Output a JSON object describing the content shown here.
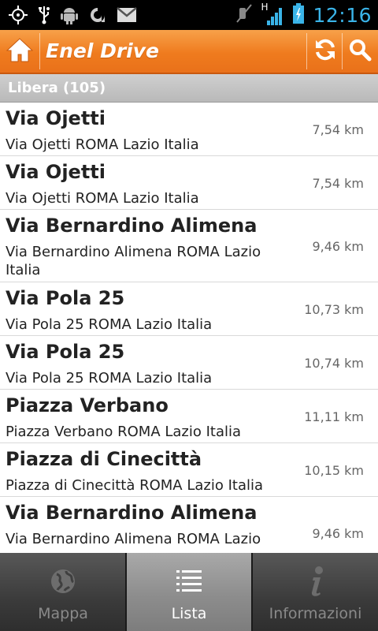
{
  "status_bar": {
    "time": "12:16",
    "network_type": "H",
    "left_icons": [
      "gps-icon",
      "usb-icon",
      "android-debug-icon",
      "app-icon",
      "gmail-icon"
    ],
    "right_icons": [
      "mute-icon",
      "signal-icon",
      "battery-charging-icon"
    ]
  },
  "action_bar": {
    "title": "Enel Drive",
    "home_icon": "home-icon",
    "refresh_icon": "refresh-icon",
    "search_icon": "search-icon",
    "color": "#ef7b1e"
  },
  "section": {
    "label": "Libera (105)"
  },
  "list": [
    {
      "title": "Via Ojetti",
      "address": "Via Ojetti ROMA Lazio Italia",
      "distance": "7,54 km"
    },
    {
      "title": "Via Ojetti",
      "address": "Via Ojetti ROMA Lazio Italia",
      "distance": "7,54 km"
    },
    {
      "title": "Via Bernardino Alimena",
      "address": "Via Bernardino Alimena ROMA Lazio Italia",
      "distance": "9,46 km"
    },
    {
      "title": "Via Pola 25",
      "address": "Via Pola 25 ROMA Lazio Italia",
      "distance": "10,73 km"
    },
    {
      "title": "Via Pola 25",
      "address": "Via Pola 25 ROMA Lazio Italia",
      "distance": "10,74 km"
    },
    {
      "title": "Piazza Verbano",
      "address": "Piazza Verbano ROMA Lazio Italia",
      "distance": "11,11 km"
    },
    {
      "title": "Piazza di Cinecittà",
      "address": "Piazza di Cinecittà ROMA Lazio Italia",
      "distance": "10,15 km"
    },
    {
      "title": "Via Bernardino Alimena",
      "address": "Via Bernardino Alimena ROMA Lazio",
      "distance": "9,46 km"
    }
  ],
  "tabs": [
    {
      "label": "Mappa",
      "icon": "globe-icon",
      "active": false
    },
    {
      "label": "Lista",
      "icon": "list-icon",
      "active": true
    },
    {
      "label": "Informazioni",
      "icon": "info-icon",
      "active": false
    }
  ]
}
